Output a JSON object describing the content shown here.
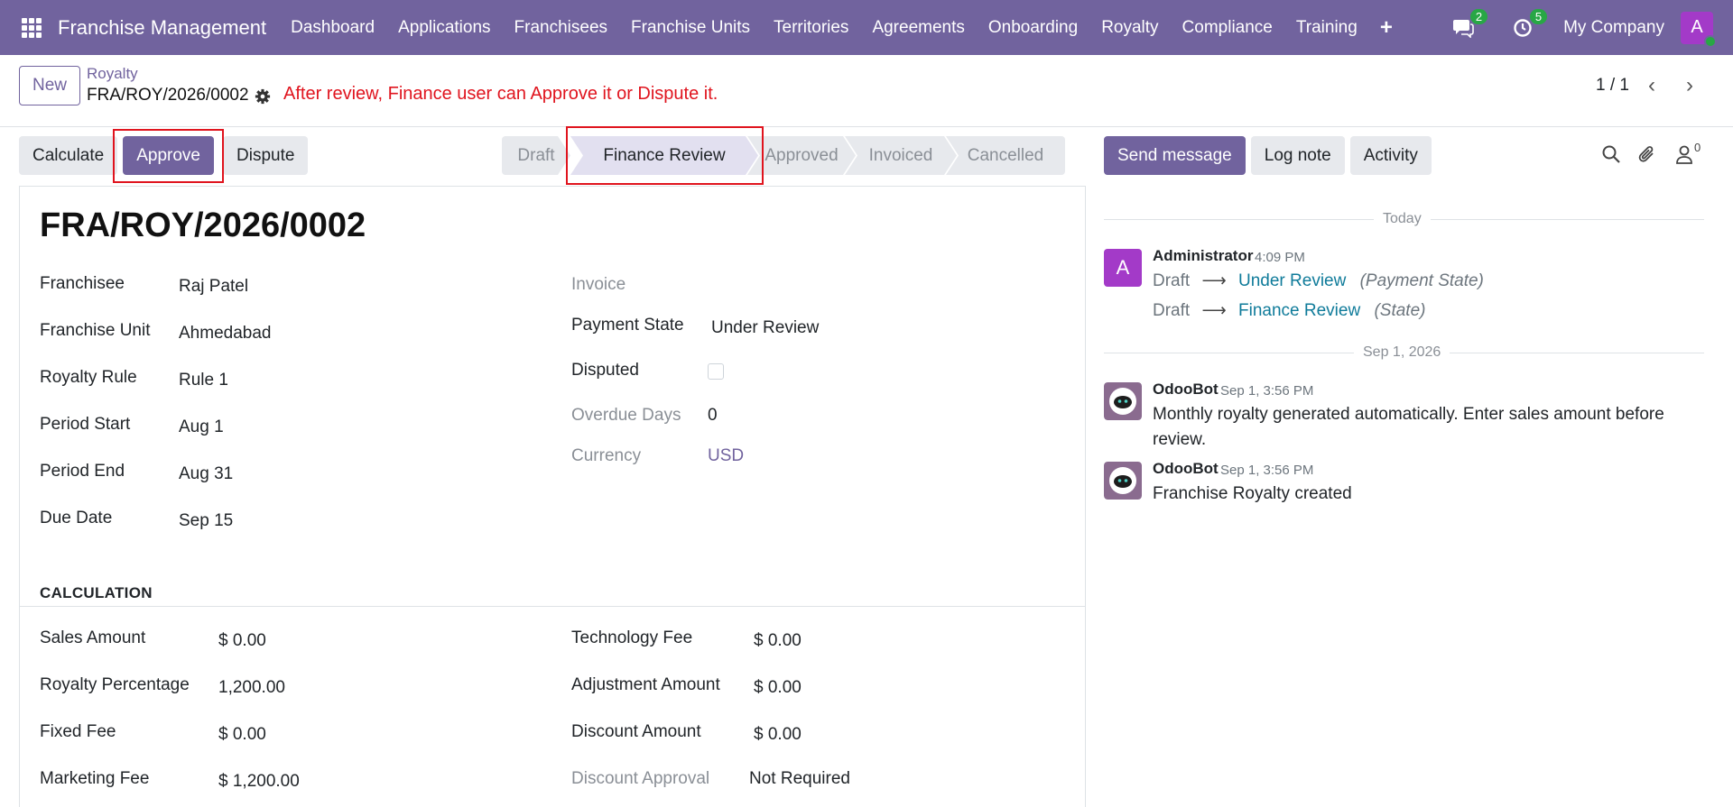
{
  "navbar": {
    "brand": "Franchise Management",
    "menu": [
      "Dashboard",
      "Applications",
      "Franchisees",
      "Franchise Units",
      "Territories",
      "Agreements",
      "Onboarding",
      "Royalty",
      "Compliance",
      "Training"
    ],
    "messages_count": "2",
    "activities_count": "5",
    "company": "My Company",
    "user_initial": "A"
  },
  "control": {
    "new_label": "New",
    "breadcrumb_parent": "Royalty",
    "breadcrumb_current": "FRA/ROY/2026/0002",
    "annotation": "After review, Finance user can Approve it or Dispute it.",
    "pager": "1 / 1"
  },
  "buttons": {
    "calculate": "Calculate",
    "approve": "Approve",
    "dispute": "Dispute"
  },
  "statusbar": [
    "Draft",
    "Finance Review",
    "Approved",
    "Invoiced",
    "Cancelled"
  ],
  "statusbar_current": "Finance Review",
  "form": {
    "title": "FRA/ROY/2026/0002",
    "left": [
      {
        "label": "Franchisee",
        "value": "Raj Patel"
      },
      {
        "label": "Franchise Unit",
        "value": "Ahmedabad"
      },
      {
        "label": "Royalty Rule",
        "value": "Rule 1"
      },
      {
        "label": "Period Start",
        "value": "Aug 1"
      },
      {
        "label": "Period End",
        "value": "Aug 31"
      },
      {
        "label": "Due Date",
        "value": "Sep 15"
      }
    ],
    "invoice_label": "Invoice",
    "payment_state_label": "Payment State",
    "payment_state_value": "Under Review",
    "disputed_label": "Disputed",
    "overdue_label": "Overdue Days",
    "overdue_value": "0",
    "currency_label": "Currency",
    "currency_value": "USD",
    "calculation_title": "CALCULATION",
    "calc_left": [
      {
        "label": "Sales Amount",
        "value": "$ 0.00"
      },
      {
        "label": "Royalty Percentage",
        "value": "1,200.00"
      },
      {
        "label": "Fixed Fee",
        "value": "$ 0.00"
      },
      {
        "label": "Marketing Fee",
        "value": "$ 1,200.00"
      }
    ],
    "calc_right": [
      {
        "label": "Technology Fee",
        "value": "$ 0.00"
      },
      {
        "label": "Adjustment Amount",
        "value": "$ 0.00"
      },
      {
        "label": "Discount Amount",
        "value": "$ 0.00"
      },
      {
        "label": "Discount Approval",
        "value": "Not Required"
      }
    ]
  },
  "chatter": {
    "send_message": "Send message",
    "log_note": "Log note",
    "activity": "Activity",
    "followers_count": "0",
    "today_label": "Today",
    "message1": {
      "author": "Administrator",
      "initial": "A",
      "time": "4:09 PM",
      "tracking": [
        {
          "old": "Draft",
          "new": "Under Review",
          "field": "(Payment State)"
        },
        {
          "old": "Draft",
          "new": "Finance Review",
          "field": "(State)"
        }
      ]
    },
    "date_label": "Sep 1, 2026",
    "message2": {
      "author": "OdooBot",
      "time": "Sep 1, 3:56 PM",
      "body": "Monthly royalty generated automatically. Enter sales amount before review."
    },
    "message3": {
      "author": "OdooBot",
      "time": "Sep 1, 3:56 PM",
      "body": "Franchise Royalty created"
    }
  },
  "colors": {
    "brand": "#71639e",
    "annotation": "#e0141e",
    "link": "#0f7b9a",
    "badge": "#28a745",
    "avatar": "#a33ac8"
  }
}
